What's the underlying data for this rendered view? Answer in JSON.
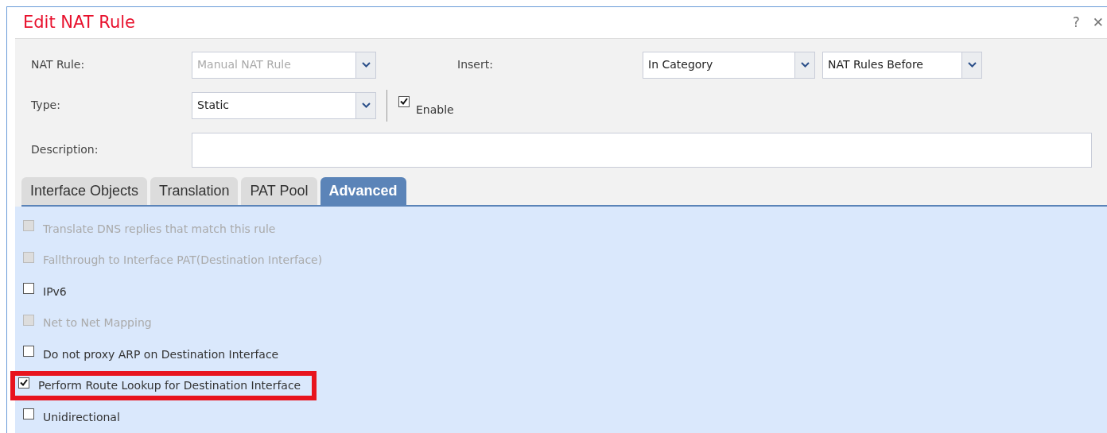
{
  "window": {
    "title": "Edit NAT Rule",
    "help": "?",
    "close": "✕"
  },
  "form": {
    "nat_rule": {
      "label": "NAT Rule:",
      "value": "Manual NAT Rule",
      "disabled": true
    },
    "insert": {
      "label": "Insert:",
      "values": [
        "In Category",
        "NAT Rules Before"
      ]
    },
    "type": {
      "label": "Type:",
      "value": "Static",
      "disabled": false
    },
    "enable": {
      "label": "Enable",
      "checked": true
    },
    "description": {
      "label": "Description:"
    }
  },
  "tabs": [
    {
      "label": "Interface Objects",
      "selected": false
    },
    {
      "label": "Translation",
      "selected": false
    },
    {
      "label": "PAT Pool",
      "selected": false
    },
    {
      "label": "Advanced",
      "selected": true
    }
  ],
  "options": [
    {
      "label": "Translate DNS replies that match this rule",
      "checked": false,
      "disabled": true,
      "highlighted": false
    },
    {
      "label": "Fallthrough to Interface PAT(Destination Interface)",
      "checked": false,
      "disabled": true,
      "highlighted": false
    },
    {
      "label": "IPv6",
      "checked": false,
      "disabled": false,
      "highlighted": false
    },
    {
      "label": "Net to Net Mapping",
      "checked": false,
      "disabled": true,
      "highlighted": false
    },
    {
      "label": "Do not proxy ARP on Destination Interface",
      "checked": false,
      "disabled": false,
      "highlighted": false
    },
    {
      "label": "Perform Route Lookup for Destination Interface",
      "checked": true,
      "disabled": false,
      "highlighted": true
    },
    {
      "label": "Unidirectional",
      "checked": false,
      "disabled": false,
      "highlighted": false
    }
  ]
}
